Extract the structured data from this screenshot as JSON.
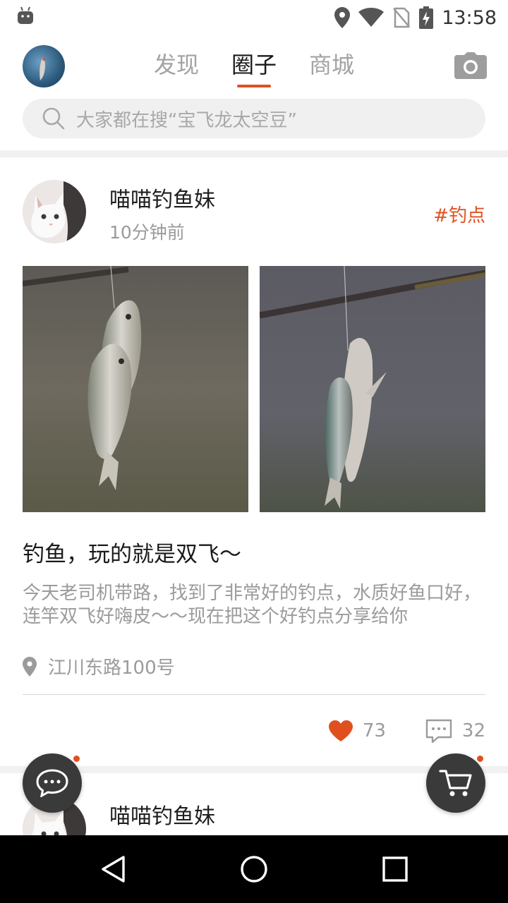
{
  "status_bar": {
    "time": "13:58",
    "icons": [
      "android-icon",
      "location-icon",
      "wifi-icon",
      "no-sim-icon",
      "battery-charging-icon"
    ]
  },
  "header": {
    "tabs": [
      {
        "label": "发现",
        "active": false
      },
      {
        "label": "圈子",
        "active": true
      },
      {
        "label": "商城",
        "active": false
      }
    ],
    "camera_icon": "camera-icon"
  },
  "search": {
    "placeholder": "大家都在搜“宝飞龙太空豆”"
  },
  "posts": [
    {
      "username": "喵喵钓鱼妹",
      "time": "10分钟前",
      "tag": "#钓点",
      "title": "钓鱼，玩的就是双飞～",
      "body": "今天老司机带路，找到了非常好的钓点，水质好鱼口好，连竿双飞好嗨皮～～现在把这个好钓点分享给你",
      "location": "江川东路100号",
      "likes": "73",
      "comments": "32"
    },
    {
      "username": "喵喵钓鱼妹"
    }
  ],
  "colors": {
    "accent": "#e0501f",
    "heart": "#e0501f",
    "fab": "#3a3a3a"
  }
}
